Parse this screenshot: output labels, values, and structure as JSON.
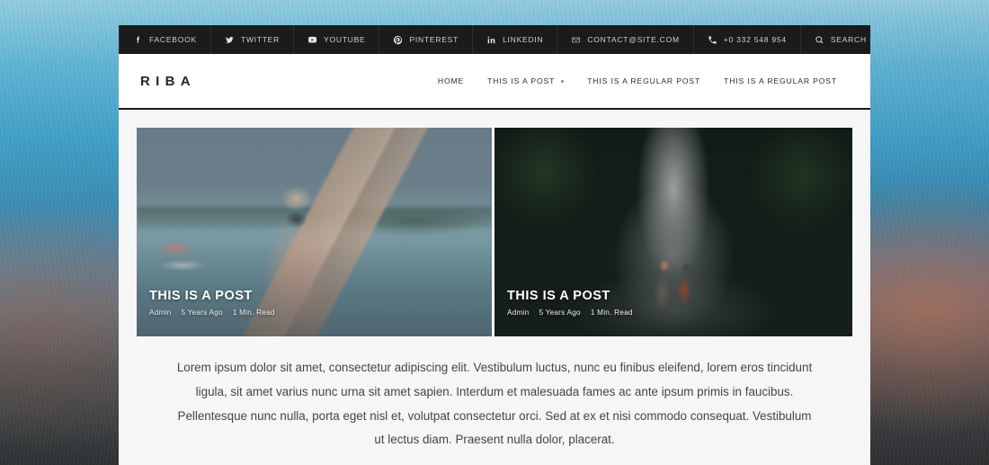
{
  "topbar": {
    "social": [
      {
        "label": "FACEBOOK",
        "icon": "facebook-icon"
      },
      {
        "label": "TWITTER",
        "icon": "twitter-icon"
      },
      {
        "label": "YOUTUBE",
        "icon": "youtube-icon"
      },
      {
        "label": "PINTEREST",
        "icon": "pinterest-icon"
      },
      {
        "label": "LINKEDIN",
        "icon": "linkedin-icon"
      }
    ],
    "contact": [
      {
        "label": "CONTACT@SITE.COM",
        "icon": "envelope-icon"
      },
      {
        "label": "+0 332 548 954",
        "icon": "phone-icon"
      },
      {
        "label": "SEARCH",
        "icon": "search-icon"
      }
    ],
    "bg_color": "#1b1b1b",
    "text_color": "#d2d2d2"
  },
  "header": {
    "logo": "RIBA",
    "nav": [
      {
        "label": "HOME",
        "has_dropdown": false
      },
      {
        "label": "THIS IS A POST",
        "has_dropdown": true
      },
      {
        "label": "THIS IS A REGULAR POST",
        "has_dropdown": false
      },
      {
        "label": "THIS IS A REGULAR POST",
        "has_dropdown": false
      }
    ],
    "bg_color": "#ffffff",
    "border_color": "#1b1b1b"
  },
  "cards": [
    {
      "title": "THIS IS A POST",
      "author": "Admin",
      "date": "5 Years Ago",
      "read_time": "1 Min. Read",
      "image_alt": "woman-with-surfboard-at-beach"
    },
    {
      "title": "THIS IS A POST",
      "author": "Admin",
      "date": "5 Years Ago",
      "read_time": "1 Min. Read",
      "image_alt": "hikers-in-front-of-waterfall"
    }
  ],
  "article": {
    "body": "Lorem ipsum dolor sit amet, consectetur adipiscing elit. Vestibulum luctus, nunc eu finibus eleifend, lorem eros tincidunt ligula, sit amet varius nunc urna sit amet sapien. Interdum et malesuada fames ac ante ipsum primis in faucibus. Pellentesque nunc nulla, porta eget nisl et, volutpat consectetur orci. Sed at ex et nisi commodo consequat. Vestibulum ut lectus diam. Praesent nulla dolor, placerat."
  },
  "content": {
    "bg_color": "#f6f6f6"
  }
}
